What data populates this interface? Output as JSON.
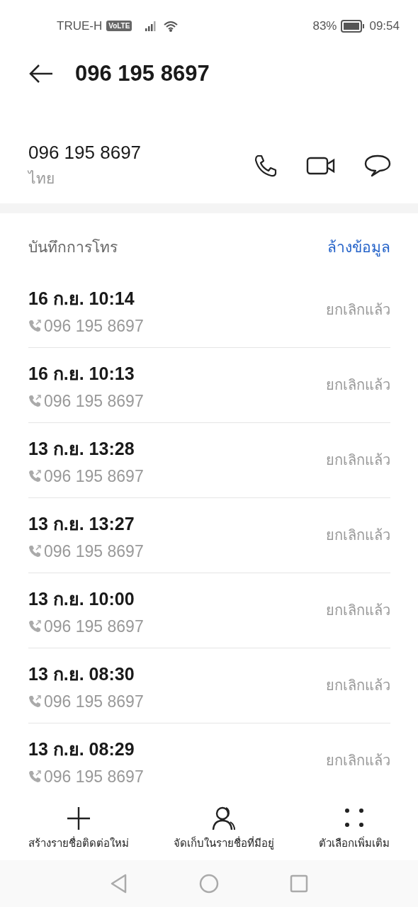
{
  "status_bar": {
    "carrier": "TRUE-H",
    "volte": "VoLTE",
    "battery": "83%",
    "time": "09:54"
  },
  "header": {
    "title": "096 195 8697"
  },
  "contact": {
    "number": "096 195 8697",
    "region": "ไทย"
  },
  "call_log": {
    "title": "บันทึกการโทร",
    "clear": "ล้างข้อมูล",
    "rows": [
      {
        "time": "16 ก.ย. 10:14",
        "number": "096 195 8697",
        "status": "ยกเลิกแล้ว"
      },
      {
        "time": "16 ก.ย. 10:13",
        "number": "096 195 8697",
        "status": "ยกเลิกแล้ว"
      },
      {
        "time": "13 ก.ย. 13:28",
        "number": "096 195 8697",
        "status": "ยกเลิกแล้ว"
      },
      {
        "time": "13 ก.ย. 13:27",
        "number": "096 195 8697",
        "status": "ยกเลิกแล้ว"
      },
      {
        "time": "13 ก.ย. 10:00",
        "number": "096 195 8697",
        "status": "ยกเลิกแล้ว"
      },
      {
        "time": "13 ก.ย. 08:30",
        "number": "096 195 8697",
        "status": "ยกเลิกแล้ว"
      },
      {
        "time": "13 ก.ย. 08:29",
        "number": "096 195 8697",
        "status": "ยกเลิกแล้ว"
      }
    ]
  },
  "actions": [
    {
      "kind": "add",
      "label": "สร้างรายชื่อติดต่อใหม่"
    },
    {
      "kind": "contact",
      "label": "จัดเก็บในรายชื่อที่มีอยู่"
    },
    {
      "kind": "more",
      "label": "ตัวเลือกเพิ่มเติม"
    }
  ]
}
